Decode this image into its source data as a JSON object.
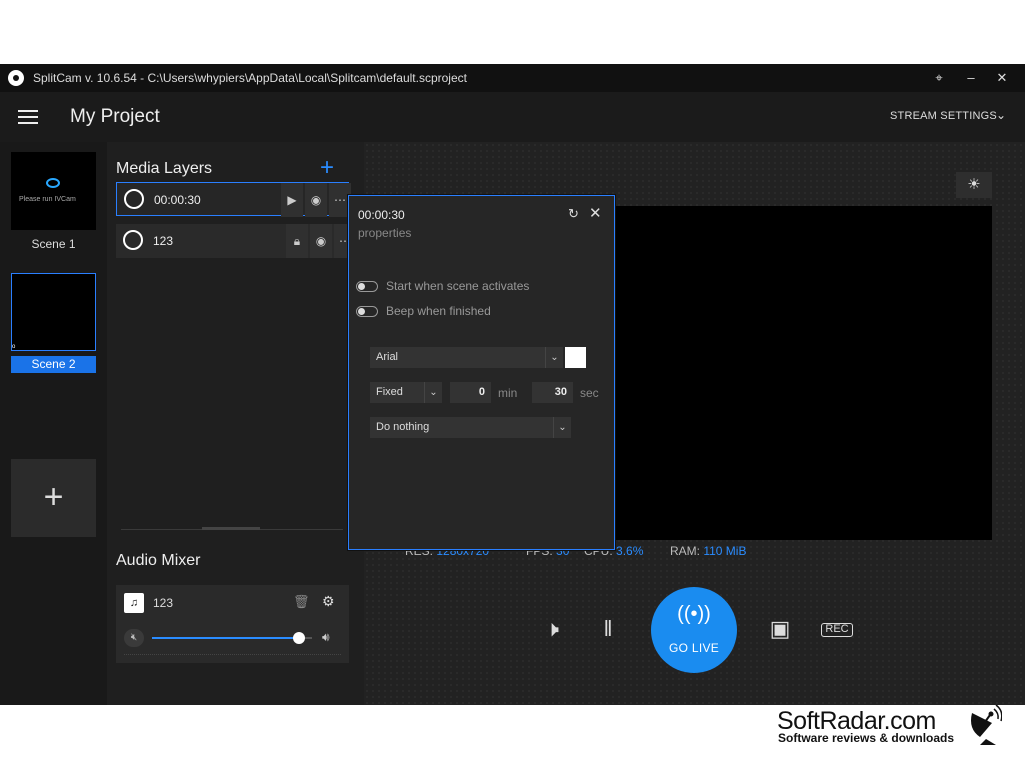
{
  "titlebar": {
    "text": "SplitCam v. 10.6.54 - C:\\Users\\whypiers\\AppData\\Local\\Splitcam\\default.scproject"
  },
  "header": {
    "project_title": "My Project",
    "stream_settings": "STREAM SETTINGS"
  },
  "scenes": [
    {
      "label": "Scene 1",
      "preview_text": "Please run IVCam",
      "active": false
    },
    {
      "label": "Scene 2",
      "active": true
    }
  ],
  "layers": {
    "title": "Media Layers",
    "items": [
      {
        "label": "00:00:30",
        "icon": "stopwatch-icon"
      },
      {
        "label": "123",
        "icon": "globe-icon"
      }
    ]
  },
  "audio": {
    "title": "Audio Mixer",
    "source": "123",
    "volume": 0.92
  },
  "stats": {
    "res_label": "RES:",
    "res": "1280x720",
    "fps_label": "FPS:",
    "fps": "30",
    "cpu_label": "CPU:",
    "cpu": "3.6%",
    "ram_label": "RAM:",
    "ram": "110 MiB"
  },
  "controls": {
    "golive": "GO LIVE"
  },
  "popup": {
    "title": "00:00:30",
    "subtitle": "properties",
    "toggle1": "Start when scene activates",
    "toggle2": "Beep when finished",
    "font": "Arial",
    "mode": "Fixed",
    "minutes": "0",
    "min_unit": "min",
    "seconds": "30",
    "sec_unit": "sec",
    "action": "Do nothing"
  },
  "watermark": {
    "title": "SoftRadar.com",
    "subtitle": "Software reviews & downloads"
  },
  "colors": {
    "accent": "#1a8cf0",
    "background": "#1e1e1e"
  }
}
